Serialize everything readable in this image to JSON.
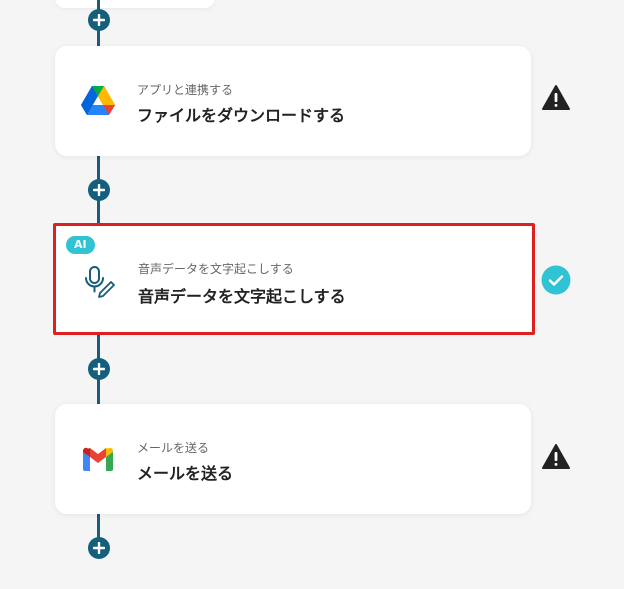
{
  "steps": [
    {
      "subtitle": "アプリと連携する",
      "title": "ファイルをダウンロードする",
      "app_icon": "google-drive-icon",
      "status": "warning"
    },
    {
      "badge": "AI",
      "subtitle": "音声データを文字起こしする",
      "title": "音声データを文字起こしする",
      "app_icon": "microphone-pen-icon",
      "status": "complete",
      "selected": true
    },
    {
      "subtitle": "メールを送る",
      "title": "メールを送る",
      "app_icon": "gmail-icon",
      "status": "warning"
    }
  ],
  "colors": {
    "flow_line": "#1e5a7a",
    "add_button": "#155e7c",
    "selected_border": "#e01f1f",
    "ai_badge": "#2fc3d4",
    "check": "#2fc3d4",
    "warning": "#222222"
  }
}
